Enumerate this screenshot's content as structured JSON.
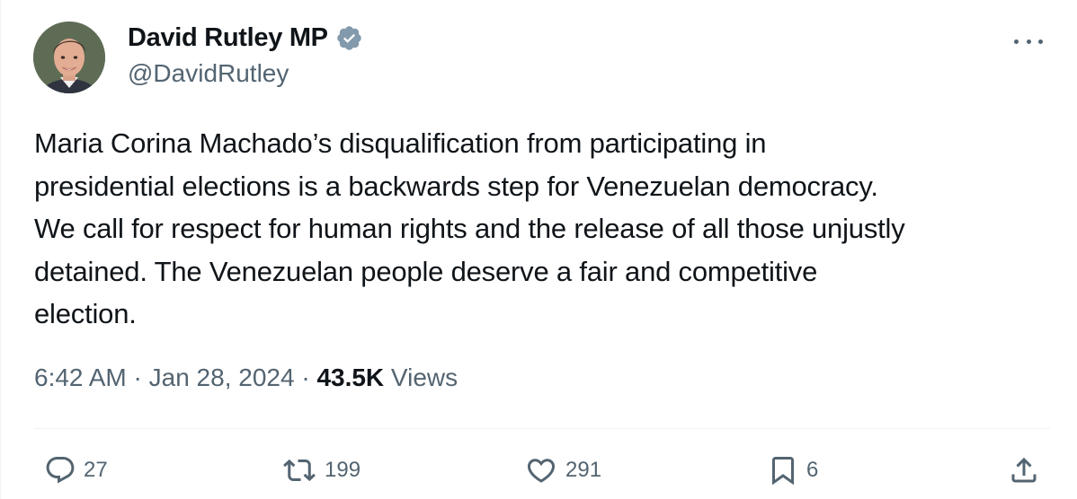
{
  "author": {
    "display_name": "David Rutley MP",
    "handle": "@DavidRutley",
    "verified_color": "#829aab"
  },
  "tweet": {
    "text": "Maria Corina Machado’s disqualification from participating in\npresidential elections is a backwards step for Venezuelan democracy.\nWe call for respect for human rights and the release of all those unjustly\ndetained. The Venezuelan people deserve a fair and competitive\nelection.",
    "time": "6:42 AM",
    "date": "Jan 28, 2024",
    "separator": " · ",
    "views_count": "43.5K",
    "views_label": " Views"
  },
  "actions": {
    "replies": "27",
    "reposts": "199",
    "likes": "291",
    "bookmarks": "6"
  },
  "icons": {
    "verified": "verified-badge-icon",
    "more": "more-icon",
    "reply": "reply-icon",
    "repost": "repost-icon",
    "like": "heart-icon",
    "bookmark": "bookmark-icon",
    "share": "share-icon"
  },
  "colors": {
    "text_primary": "#0f1419",
    "text_secondary": "#536471"
  }
}
